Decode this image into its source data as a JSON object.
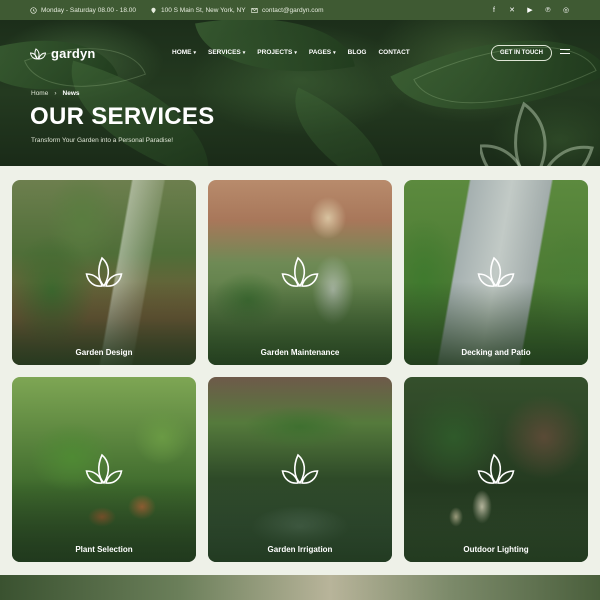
{
  "topbar": {
    "hours": "Monday - Saturday 08.00 - 18.00",
    "address": "100 S Main St, New York, NY",
    "email": "contact@gardyn.com",
    "socials": [
      "facebook-icon",
      "x-icon",
      "youtube-icon",
      "pinterest-icon",
      "instagram-icon"
    ]
  },
  "nav": {
    "logo_text": "gardyn",
    "items": [
      {
        "label": "HOME",
        "dropdown": true
      },
      {
        "label": "SERVICES",
        "dropdown": true
      },
      {
        "label": "PROJECTS",
        "dropdown": true
      },
      {
        "label": "PAGES",
        "dropdown": true
      },
      {
        "label": "BLOG",
        "dropdown": false
      },
      {
        "label": "CONTACT",
        "dropdown": false
      }
    ],
    "cta_label": "GET IN TOUCH"
  },
  "hero": {
    "breadcrumb_home": "Home",
    "breadcrumb_current": "News",
    "title": "OUR SERVICES",
    "subtitle": "Transform Your Garden into a Personal Paradise!"
  },
  "services": [
    {
      "label": "Garden Design"
    },
    {
      "label": "Garden Maintenance"
    },
    {
      "label": "Decking and Patio"
    },
    {
      "label": "Plant Selection"
    },
    {
      "label": "Garden Irrigation"
    },
    {
      "label": "Outdoor Lighting"
    }
  ],
  "colors": {
    "brand_green": "#3f5a33",
    "page_bg": "#eef1e8"
  }
}
